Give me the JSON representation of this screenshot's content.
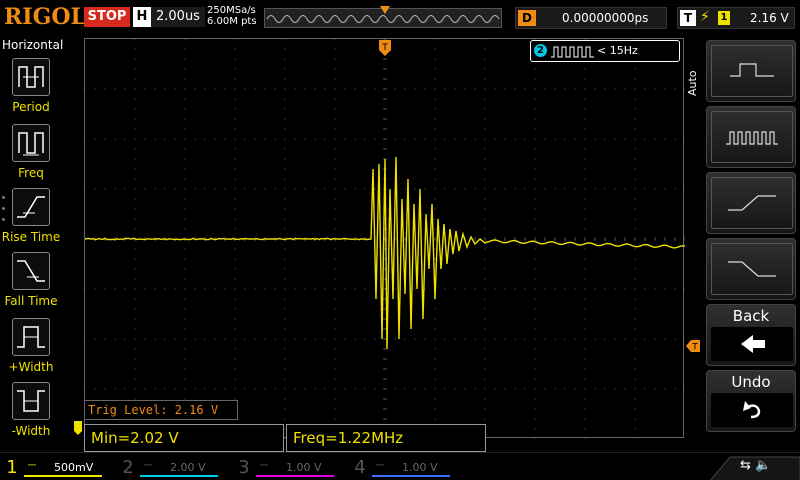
{
  "top": {
    "brand": "RIGOL",
    "run_state": "STOP",
    "horizontal_letter": "H",
    "timebase": "2.00us",
    "sample_rate": "250MSa/s",
    "memory_depth": "6.00M pts",
    "delay_letter": "D",
    "delay": "0.00000000ps",
    "trigger_letter": "T",
    "trigger_edge": "rising-edge-icon",
    "trigger_channel": "1",
    "trigger_level": "2.16 V"
  },
  "left_menu": {
    "title": "Horizontal",
    "items": [
      {
        "label": "Period",
        "icon": "period-icon"
      },
      {
        "label": "Freq",
        "icon": "freq-icon"
      },
      {
        "label": "Rise Time",
        "icon": "rise-time-icon"
      },
      {
        "label": "Fall Time",
        "icon": "fall-time-icon"
      },
      {
        "label": "+Width",
        "icon": "positive-width-icon"
      },
      {
        "label": "-Width",
        "icon": "negative-width-icon"
      }
    ]
  },
  "counter": {
    "channel": "2",
    "value": "< 15Hz"
  },
  "overlay": {
    "trig_level": "Trig Level: 2.16 V",
    "measurement_min": "Min=2.02 V",
    "measurement_freq": "Freq=1.22MHz"
  },
  "right_menu": {
    "auto_label": "Auto",
    "softkeys": [
      {
        "icon": "square-wave-icon"
      },
      {
        "icon": "pulse-train-icon"
      },
      {
        "icon": "rising-ramp-icon"
      },
      {
        "icon": "falling-ramp-icon"
      },
      {
        "label": "Back",
        "icon": "back-arrow-icon"
      },
      {
        "label": "Undo",
        "icon": "undo-icon"
      }
    ]
  },
  "channels": [
    {
      "num": "1",
      "coupling": "DC",
      "scale": "500mV",
      "color": "#f0e000",
      "active": true
    },
    {
      "num": "2",
      "coupling": "DC",
      "scale": "2.00 V",
      "color": "#00c8e6",
      "active": false
    },
    {
      "num": "3",
      "coupling": "DC",
      "scale": "1.00 V",
      "color": "#e000e0",
      "active": false
    },
    {
      "num": "4",
      "coupling": "DC",
      "scale": "1.00 V",
      "color": "#3a6cff",
      "active": false
    }
  ],
  "colors": {
    "ch1": "#f0e000",
    "ch2": "#00c8e6",
    "ch3": "#e000e0",
    "ch4": "#3a6cff",
    "accent": "#f08c14",
    "stop": "#d62a1e"
  }
}
